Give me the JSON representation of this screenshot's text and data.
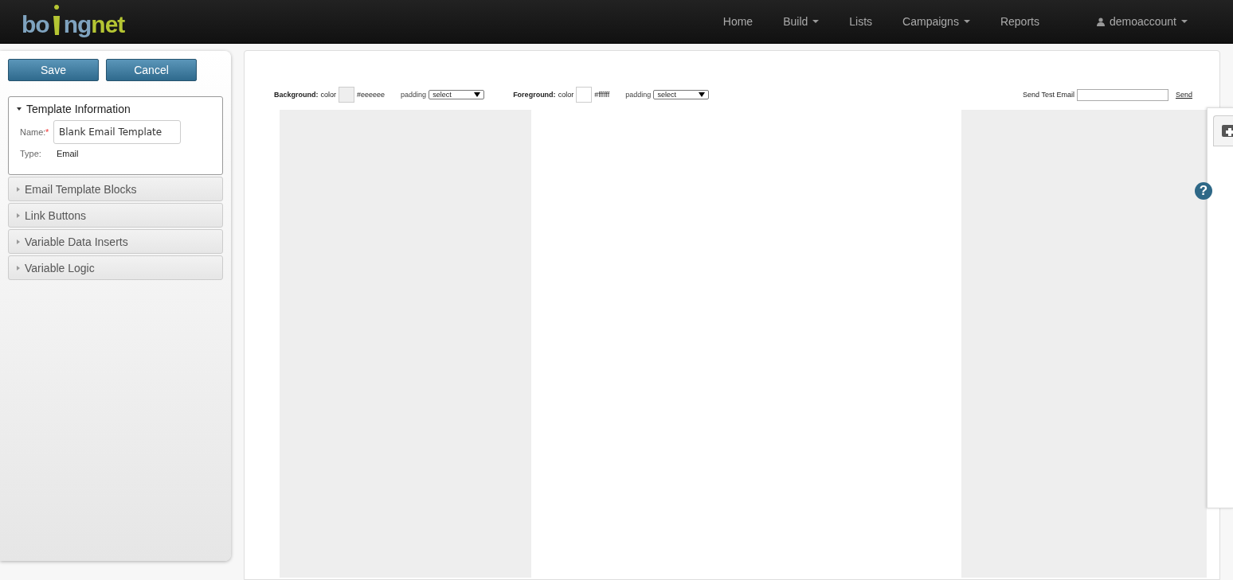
{
  "logo": {
    "part_1": "bo",
    "part_2": "ng",
    "part_3": "net"
  },
  "nav": [
    {
      "label": "Home",
      "dropdown": false
    },
    {
      "label": "Build",
      "dropdown": true
    },
    {
      "label": "Lists",
      "dropdown": false
    },
    {
      "label": "Campaigns",
      "dropdown": true
    },
    {
      "label": "Reports",
      "dropdown": false
    }
  ],
  "user_menu": {
    "label": "demoaccount",
    "dropdown": true
  },
  "sidebar": {
    "buttons": [
      "Save",
      "Cancel"
    ],
    "sections": [
      {
        "title": "Template Information",
        "expanded": true,
        "fields": [
          {
            "label": "Name:",
            "required_mark": "*",
            "kind": "input",
            "value": "Blank Email Template"
          },
          {
            "label": "Type:",
            "kind": "text",
            "value": "Email"
          }
        ]
      },
      {
        "title": "Email Template Blocks",
        "expanded": false
      },
      {
        "title": "Link Buttons",
        "expanded": false
      },
      {
        "title": "Variable Data Inserts",
        "expanded": false
      },
      {
        "title": "Variable Logic",
        "expanded": false
      }
    ]
  },
  "toolbar": {
    "groups": [
      {
        "title": "Background:",
        "color_label": "color",
        "color": "#eeeeee",
        "color_value": "#eeeeee",
        "padding_label": "padding",
        "padding_value": "select"
      },
      {
        "title": "Foreground:",
        "color_label": "color",
        "color": "#ffffff",
        "color_value": "#ffffff",
        "padding_label": "padding",
        "padding_value": "select"
      }
    ],
    "test_email": {
      "label": "Send Test Email",
      "button": "Send"
    }
  },
  "help": {
    "label": "?"
  }
}
